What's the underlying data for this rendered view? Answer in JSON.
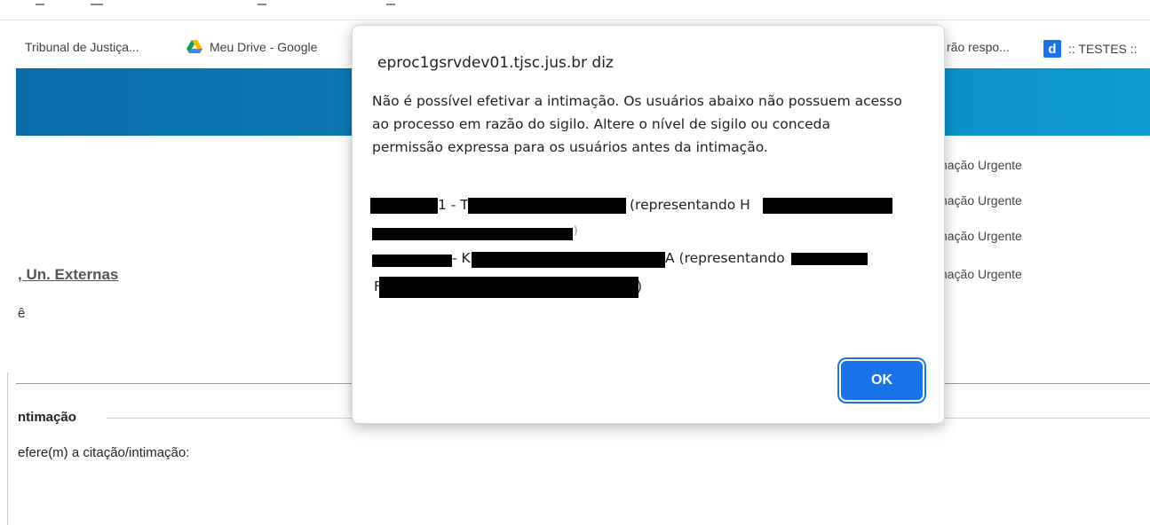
{
  "bookmarks": {
    "items": [
      {
        "label": "Tribunal de Justiça..."
      },
      {
        "label": "Meu Drive - Google"
      },
      {
        "label": "rão respo..."
      },
      {
        "label": ":: TESTES ::"
      }
    ],
    "d_icon_letter": "d"
  },
  "page": {
    "urgent_items": [
      "imação Urgente",
      "imação Urgente",
      "imação Urgente",
      "imação Urgente"
    ],
    "un_externas": ", Un. Externas",
    "cut_char": "ê",
    "intimacao_legend": "ntimação",
    "refere_text": "efere(m) a citação/intimação:"
  },
  "dialog": {
    "title": "eproc1gsrvdev01.tjsc.jus.br diz",
    "message": "Não é possível efetivar a intimação. Os usuários abaixo não possuem acesso ao processo em razão do sigilo. Altere o nível de sigilo ou conceda permissão expressa para os usuários antes da intimação.",
    "line1_a": "1 - T",
    "line1_b": "(representando H",
    "line2_tail": ")",
    "line3_a": "- K",
    "line3_b": "A (representando",
    "line4_a": "F",
    "line4_b": ")",
    "ok_label": "OK"
  },
  "colors": {
    "banner": "#0c84bd",
    "ok_button": "#1a73e8"
  }
}
